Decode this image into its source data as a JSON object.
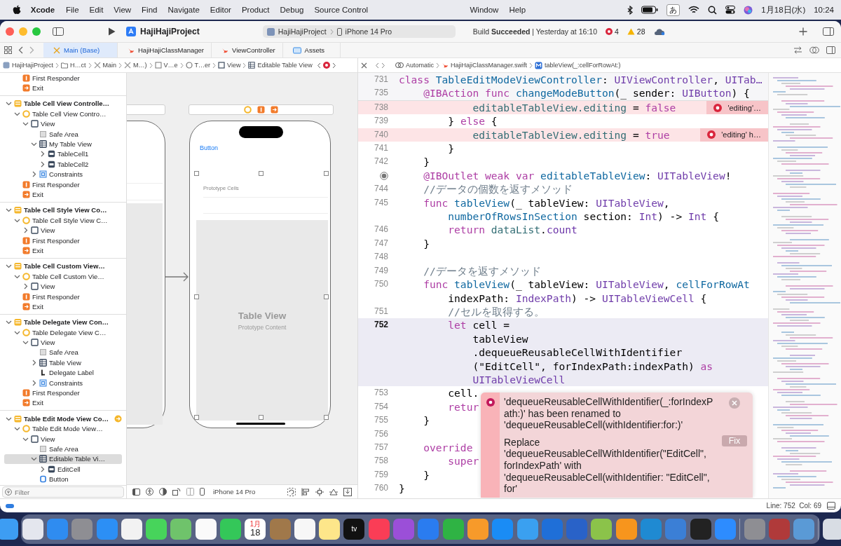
{
  "menu_bar": {
    "app_name": "Xcode",
    "menus": [
      "File",
      "Edit",
      "View",
      "Find",
      "Navigate",
      "Editor",
      "Product",
      "Debug",
      "Source Control"
    ],
    "extra_menus": [
      "Window",
      "Help"
    ],
    "input_mode": "あ",
    "date": "1月18日(水)",
    "time": "10:24"
  },
  "toolbar": {
    "project": "HajiHajiProject",
    "scheme": "HajiHajiProject",
    "device": "iPhone 14 Pro",
    "build_status": "Build **Succeeded** | Yesterday at 16:10",
    "errors": "4",
    "warnings": "28"
  },
  "tabs": [
    {
      "label": "Main (Base)",
      "kind": "storyboard",
      "selected": true
    },
    {
      "label": "HajiHajiClassManager",
      "kind": "swift",
      "selected": false
    },
    {
      "label": "ViewController",
      "kind": "swift",
      "selected": false
    },
    {
      "label": "Assets",
      "kind": "assets",
      "selected": false
    }
  ],
  "navigator_jump_bar": [
    {
      "label": "HajiHajiProject",
      "kind": "project"
    },
    {
      "label": "H…ct",
      "kind": "folder"
    },
    {
      "label": "Main",
      "kind": "storyboard"
    },
    {
      "label": "M…)",
      "kind": "storyboard"
    },
    {
      "label": "V…e",
      "kind": "scene"
    },
    {
      "label": "T…er",
      "kind": "controller"
    },
    {
      "label": "View",
      "kind": "view"
    },
    {
      "label": "Editable Table View",
      "kind": "table"
    }
  ],
  "sidebar": {
    "leading_items": [
      {
        "label": "First Responder",
        "kind": "responder",
        "selected": false
      },
      {
        "label": "Exit",
        "kind": "exit",
        "selected": false
      }
    ],
    "scenes": [
      {
        "label": "Table Cell View Controlle…",
        "kind": "scene",
        "expanded": true,
        "selected": false,
        "initial": false,
        "children": [
          {
            "label": "Table Cell View Contro…",
            "kind": "controller",
            "expanded": true,
            "selected": false,
            "children": [
              {
                "label": "View",
                "kind": "view",
                "expanded": true,
                "selected": false,
                "children": [
                  {
                    "label": "Safe Area",
                    "kind": "safe_area",
                    "selected": false
                  },
                  {
                    "label": "My Table View",
                    "kind": "table",
                    "expanded": true,
                    "selected": false,
                    "children": [
                      {
                        "label": "TableCell1",
                        "kind": "cell",
                        "expanded": false,
                        "selected": false
                      },
                      {
                        "label": "TableCell2",
                        "kind": "cell",
                        "expanded": false,
                        "selected": false
                      }
                    ]
                  },
                  {
                    "label": "Constraints",
                    "kind": "constraints",
                    "expanded": false,
                    "selected": false
                  }
                ]
              }
            ]
          },
          {
            "label": "First Responder",
            "kind": "responder",
            "selected": false
          },
          {
            "label": "Exit",
            "kind": "exit",
            "selected": false
          }
        ]
      },
      {
        "label": "Table Cell Style View Co…",
        "kind": "scene",
        "expanded": true,
        "selected": false,
        "initial": false,
        "children": [
          {
            "label": "Table Cell Style View C…",
            "kind": "controller",
            "expanded": true,
            "selected": false,
            "children": [
              {
                "label": "View",
                "kind": "view",
                "expanded": false,
                "selected": false
              }
            ]
          },
          {
            "label": "First Responder",
            "kind": "responder",
            "selected": false
          },
          {
            "label": "Exit",
            "kind": "exit",
            "selected": false
          }
        ]
      },
      {
        "label": "Table Cell Custom View…",
        "kind": "scene",
        "expanded": true,
        "selected": false,
        "initial": false,
        "children": [
          {
            "label": "Table Cell Custom Vie…",
            "kind": "controller",
            "expanded": true,
            "selected": false,
            "children": [
              {
                "label": "View",
                "kind": "view",
                "expanded": false,
                "selected": false
              }
            ]
          },
          {
            "label": "First Responder",
            "kind": "responder",
            "selected": false
          },
          {
            "label": "Exit",
            "kind": "exit",
            "selected": false
          }
        ]
      },
      {
        "label": "Table Delegate View Con…",
        "kind": "scene",
        "expanded": true,
        "selected": false,
        "initial": false,
        "children": [
          {
            "label": "Table Delegate View C…",
            "kind": "controller",
            "expanded": true,
            "selected": false,
            "children": [
              {
                "label": "View",
                "kind": "view",
                "expanded": true,
                "selected": false,
                "children": [
                  {
                    "label": "Safe Area",
                    "kind": "safe_area",
                    "selected": false
                  },
                  {
                    "label": "Table View",
                    "kind": "table",
                    "expanded": false,
                    "selected": false
                  },
                  {
                    "label": "Delegate Label",
                    "kind": "label",
                    "selected": false
                  },
                  {
                    "label": "Constraints",
                    "kind": "constraints",
                    "expanded": false,
                    "selected": false
                  }
                ]
              }
            ]
          },
          {
            "label": "First Responder",
            "kind": "responder",
            "selected": false
          },
          {
            "label": "Exit",
            "kind": "exit",
            "selected": false
          }
        ]
      },
      {
        "label": "Table Edit Mode View Co…",
        "kind": "scene",
        "expanded": true,
        "selected": false,
        "initial": true,
        "children": [
          {
            "label": "Table Edit Mode View…",
            "kind": "controller",
            "expanded": true,
            "selected": false,
            "children": [
              {
                "label": "View",
                "kind": "view",
                "expanded": true,
                "selected": false,
                "children": [
                  {
                    "label": "Safe Area",
                    "kind": "safe_area",
                    "selected": false
                  },
                  {
                    "label": "Editable Table Vi…",
                    "kind": "table",
                    "expanded": true,
                    "selected": true,
                    "children": [
                      {
                        "label": "EditCell",
                        "kind": "cell",
                        "expanded": false,
                        "selected": false
                      }
                    ]
                  },
                  {
                    "label": "Button",
                    "kind": "button",
                    "selected": false
                  }
                ]
              }
            ]
          }
        ]
      }
    ],
    "filter_placeholder": "Filter"
  },
  "canvas": {
    "button_label": "Button",
    "section_label": "Prototype Cells",
    "table_title": "Table View",
    "table_subtitle": "Prototype Content",
    "device": "iPhone 14 Pro"
  },
  "editor": {
    "jump_bar": [
      {
        "label": "Automatic",
        "kind": "related"
      },
      {
        "label": "HajiHajiClassManager.swift",
        "kind": "swift"
      },
      {
        "label": "tableView(_:cellForRowAt:)",
        "kind": "method"
      }
    ],
    "sticky_rows": [
      {
        "number": "731",
        "text_lines": [
          [
            {
              "kind": "keyword",
              "text": "class "
            },
            {
              "kind": "declaration",
              "text": "TableEditModeViewController"
            },
            {
              "kind": "plain",
              "text": ": "
            },
            {
              "kind": "type",
              "text": "UIViewController"
            },
            {
              "kind": "plain",
              "text": ", "
            },
            {
              "kind": "type",
              "text": "UITab…"
            }
          ]
        ]
      },
      {
        "number": "735",
        "text_lines": [
          [
            {
              "kind": "keyword",
              "text": "    @IBAction func "
            },
            {
              "kind": "declaration",
              "text": "changeModeButton"
            },
            {
              "kind": "plain",
              "text": "(_ sender: "
            },
            {
              "kind": "type",
              "text": "UIButton"
            },
            {
              "kind": "plain",
              "text": ") {"
            }
          ]
        ]
      }
    ],
    "rows": [
      {
        "number": "738",
        "kind": "error",
        "issue": "'editing'…",
        "text_lines": [
          [
            {
              "kind": "reference",
              "text": "            editableTableView.editing"
            },
            {
              "kind": "plain",
              "text": " = "
            },
            {
              "kind": "keyword",
              "text": "false"
            }
          ]
        ]
      },
      {
        "number": "739",
        "kind": "plain",
        "text_lines": [
          [
            {
              "kind": "plain",
              "text": "        } "
            },
            {
              "kind": "keyword",
              "text": "else"
            },
            {
              "kind": "plain",
              "text": " {"
            }
          ]
        ]
      },
      {
        "number": "740",
        "kind": "error",
        "issue": "'editing' h…",
        "text_lines": [
          [
            {
              "kind": "reference",
              "text": "            editableTableView.editing"
            },
            {
              "kind": "plain",
              "text": " = "
            },
            {
              "kind": "keyword",
              "text": "true"
            }
          ]
        ]
      },
      {
        "number": "741",
        "kind": "plain",
        "text_lines": [
          [
            {
              "kind": "plain",
              "text": "        }"
            }
          ]
        ]
      },
      {
        "number": "742",
        "kind": "plain",
        "text_lines": [
          [
            {
              "kind": "plain",
              "text": "    }"
            }
          ]
        ]
      },
      {
        "kind": "plain",
        "outlet": true,
        "text_lines": [
          [
            {
              "kind": "keyword",
              "text": "    @IBOutlet weak var "
            },
            {
              "kind": "declaration",
              "text": "editableTableView"
            },
            {
              "kind": "plain",
              "text": ": "
            },
            {
              "kind": "type",
              "text": "UITableView"
            },
            {
              "kind": "plain",
              "text": "!"
            }
          ]
        ]
      },
      {
        "number": "744",
        "kind": "plain",
        "text_lines": [
          [
            {
              "kind": "comment",
              "text": "    //データの個数を返すメソッド"
            }
          ]
        ]
      },
      {
        "number": "745",
        "kind": "plain",
        "text_lines": [
          [
            {
              "kind": "keyword",
              "text": "    func "
            },
            {
              "kind": "declaration",
              "text": "tableView"
            },
            {
              "kind": "plain",
              "text": "(_ tableView: "
            },
            {
              "kind": "type",
              "text": "UITableView"
            },
            {
              "kind": "plain",
              "text": ","
            }
          ],
          [
            {
              "kind": "declaration",
              "text": "        numberOfRowsInSection"
            },
            {
              "kind": "plain",
              "text": " section: "
            },
            {
              "kind": "type",
              "text": "Int"
            },
            {
              "kind": "plain",
              "text": ") -> "
            },
            {
              "kind": "type",
              "text": "Int"
            },
            {
              "kind": "plain",
              "text": " {"
            }
          ]
        ]
      },
      {
        "number": "746",
        "kind": "plain",
        "text_lines": [
          [
            {
              "kind": "keyword",
              "text": "        return "
            },
            {
              "kind": "reference",
              "text": "dataList"
            },
            {
              "kind": "plain",
              "text": "."
            },
            {
              "kind": "member",
              "text": "count"
            }
          ]
        ]
      },
      {
        "number": "747",
        "kind": "plain",
        "text_lines": [
          [
            {
              "kind": "plain",
              "text": "    }"
            }
          ]
        ]
      },
      {
        "number": "748",
        "kind": "plain"
      },
      {
        "number": "749",
        "kind": "plain",
        "text_lines": [
          [
            {
              "kind": "comment",
              "text": "    //データを返すメソッド"
            }
          ]
        ]
      },
      {
        "number": "750",
        "kind": "plain",
        "text_lines": [
          [
            {
              "kind": "keyword",
              "text": "    func "
            },
            {
              "kind": "declaration",
              "text": "tableView"
            },
            {
              "kind": "plain",
              "text": "(_ tableView: "
            },
            {
              "kind": "type",
              "text": "UITableView"
            },
            {
              "kind": "plain",
              "text": ", "
            },
            {
              "kind": "declaration",
              "text": "cellForRowAt"
            }
          ],
          [
            {
              "kind": "plain",
              "text": "        indexPath: "
            },
            {
              "kind": "type",
              "text": "IndexPath"
            },
            {
              "kind": "plain",
              "text": ") -> "
            },
            {
              "kind": "type",
              "text": "UITableViewCell"
            },
            {
              "kind": "plain",
              "text": " {"
            }
          ]
        ]
      },
      {
        "number": "751",
        "kind": "plain",
        "text_lines": [
          [
            {
              "kind": "comment",
              "text": "        //セルを取得する。"
            }
          ]
        ]
      },
      {
        "number": "752",
        "kind": "current",
        "text_lines": [
          [
            {
              "kind": "keyword",
              "text": "        let "
            },
            {
              "kind": "plain",
              "text": "cell ="
            }
          ],
          [
            {
              "kind": "plain",
              "text": "            tableView"
            }
          ],
          [
            {
              "kind": "plain",
              "text": "            .dequeueReusableCellWithIdentifier"
            }
          ],
          [
            {
              "kind": "plain",
              "text": "            (\"EditCell\", forIndexPath:indexPath) "
            },
            {
              "kind": "keyword",
              "text": "as"
            }
          ],
          [
            {
              "kind": "type",
              "text": "            UITableViewCell"
            }
          ]
        ]
      },
      {
        "number": "753",
        "kind": "plain",
        "text_lines": [
          [
            {
              "kind": "plain",
              "text": "        cell."
            }
          ]
        ]
      },
      {
        "number": "754",
        "kind": "plain",
        "text_lines": [
          [
            {
              "kind": "keyword",
              "text": "        retur"
            }
          ]
        ]
      },
      {
        "number": "755",
        "kind": "plain",
        "text_lines": [
          [
            {
              "kind": "plain",
              "text": "    }"
            }
          ]
        ]
      },
      {
        "number": "756",
        "kind": "plain"
      },
      {
        "number": "757",
        "kind": "plain",
        "text_lines": [
          [
            {
              "kind": "keyword",
              "text": "    override"
            }
          ]
        ]
      },
      {
        "number": "758",
        "kind": "plain",
        "text_lines": [
          [
            {
              "kind": "keyword",
              "text": "        super"
            }
          ]
        ]
      },
      {
        "number": "759",
        "kind": "plain",
        "text_lines": [
          [
            {
              "kind": "plain",
              "text": "    }"
            }
          ]
        ]
      },
      {
        "number": "760",
        "kind": "plain",
        "text_lines": [
          [
            {
              "kind": "plain",
              "text": "}"
            }
          ]
        ]
      }
    ],
    "issue_popup": {
      "message": "'dequeueReusableCellWithIdentifier(_:forIndexPath:)' has been renamed to 'dequeueReusableCell(withIdentifier:for:)'",
      "fix": "Replace 'dequeueReusableCellWithIdentifier(\"EditCell\", forIndexPath' with 'dequeueReusableCell(withIdentifier: \"EditCell\", for'",
      "fix_button": "Fix"
    }
  },
  "status_bar": {
    "position": "Line: 752  Col: 69"
  },
  "dock": {
    "items": [
      {
        "kind": "app",
        "color": "#3d9df3"
      },
      {
        "kind": "app",
        "color": "#e4e6ee"
      },
      {
        "kind": "app",
        "color": "#2f8cf0"
      },
      {
        "kind": "app",
        "color": "#8e8e93"
      },
      {
        "kind": "app",
        "color": "#2c8ff5"
      },
      {
        "kind": "app",
        "color": "#f2f2f2"
      },
      {
        "kind": "app",
        "color": "#47d45b"
      },
      {
        "kind": "app",
        "color": "#6fc36b"
      },
      {
        "kind": "app",
        "color": "#fafafa"
      },
      {
        "kind": "app",
        "color": "#34c759"
      },
      {
        "kind": "app",
        "color": "#ffffff",
        "texts": [
          "1月",
          "18"
        ]
      },
      {
        "kind": "app",
        "color": "#a0784a"
      },
      {
        "kind": "app",
        "color": "#f7f7f7"
      },
      {
        "kind": "app",
        "color": "#fde68a"
      },
      {
        "kind": "app",
        "color": "#111111",
        "texts": [
          "tv"
        ]
      },
      {
        "kind": "app",
        "color": "#fa3d56"
      },
      {
        "kind": "app",
        "color": "#9b4fd8"
      },
      {
        "kind": "app",
        "color": "#2a7cf0"
      },
      {
        "kind": "app",
        "color": "#2fb344"
      },
      {
        "kind": "app",
        "color": "#f79a2a"
      },
      {
        "kind": "app",
        "color": "#1a8cf5"
      },
      {
        "kind": "app",
        "color": "#3aa0f0"
      },
      {
        "kind": "app",
        "color": "#1f6fd8"
      },
      {
        "kind": "app",
        "color": "#2962c8"
      },
      {
        "kind": "app",
        "color": "#8bc34a"
      },
      {
        "kind": "app",
        "color": "#f7951d"
      },
      {
        "kind": "app",
        "color": "#1f8ad2"
      },
      {
        "kind": "app",
        "color": "#3b7fd6"
      },
      {
        "kind": "app",
        "color": "#222222"
      },
      {
        "kind": "app",
        "color": "#2d8cff"
      },
      {
        "kind": "separator"
      },
      {
        "kind": "app",
        "color": "#8e8e93"
      },
      {
        "kind": "app",
        "color": "#b03a3a"
      },
      {
        "kind": "app",
        "color": "#5a9ad6"
      },
      {
        "kind": "separator"
      },
      {
        "kind": "app",
        "color": "#d8dde4"
      }
    ]
  }
}
